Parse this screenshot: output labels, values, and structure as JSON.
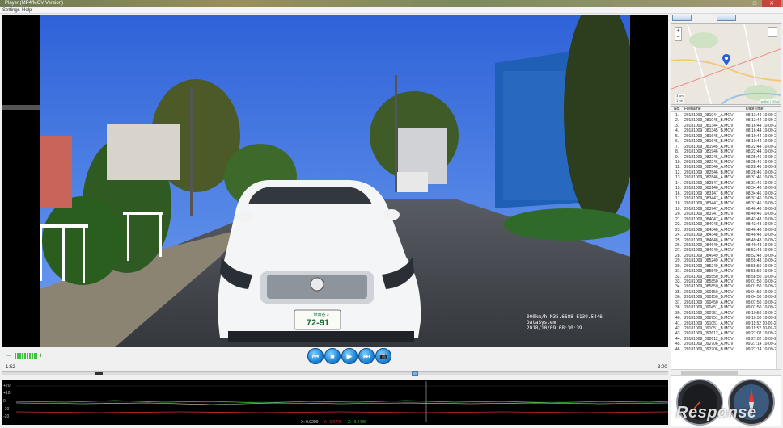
{
  "window": {
    "title": "Player (MP4/MOV Version)",
    "close": "✕"
  },
  "menu": {
    "settings": "Settings",
    "help": "Help"
  },
  "video": {
    "overlay_line1": "000km/h N35.6688 E139.5446",
    "overlay_line2": "DataSystem",
    "overlay_line3": "2018/10/09 08:30:39",
    "plate_top": "世田谷 3",
    "plate_num": "72-91"
  },
  "volume": {
    "minus": "−",
    "plus": "+"
  },
  "controls": {
    "prev": "⏮",
    "stop": "■",
    "play": "▶",
    "next": "⏭",
    "snapshot": "📷"
  },
  "playback": {
    "elapsed": "1:52",
    "duration": "3:00",
    "progress": 0.62
  },
  "graph": {
    "y_labels": [
      "+20",
      "+10",
      "0",
      "-10",
      "-20"
    ],
    "readout_x": "X: 0.0200",
    "readout_y": "Y: -0.0706",
    "readout_z": "Z: -0.2436"
  },
  "map": {
    "label_scale": "3 km",
    "label_scale2": "1 mi",
    "attrib": "Leaflet | OSM"
  },
  "filelist": {
    "headers": {
      "no": "No.",
      "filename": "Filename",
      "datetime": "DateTime"
    },
    "rows": [
      [
        "1.",
        "20181009_081044_A.MOV",
        "08:13:44 10-09-2"
      ],
      [
        "2.",
        "20181009_081045_B.MOV",
        "08:13:44 10-09-2"
      ],
      [
        "3.",
        "20181009_081344_A.MOV",
        "08:16:44 10-09-2"
      ],
      [
        "4.",
        "20181009_081345_B.MOV",
        "08:16:44 10-09-2"
      ],
      [
        "5.",
        "20181009_081645_A.MOV",
        "08:19:44 10-09-2"
      ],
      [
        "6.",
        "20181009_081645_B.MOV",
        "08:19:44 10-09-2"
      ],
      [
        "7.",
        "20181009_081945_A.MOV",
        "08:22:44 10-09-2"
      ],
      [
        "8.",
        "20181009_081946_B.MOV",
        "08:22:44 10-09-2"
      ],
      [
        "9.",
        "20181009_082246_A.MOV",
        "08:25:46 10-09-2"
      ],
      [
        "10.",
        "20181009_082246_B.MOV",
        "08:25:46 10-09-2"
      ],
      [
        "11.",
        "20181009_082546_A.MOV",
        "08:28:46 10-09-2"
      ],
      [
        "12.",
        "20181009_082546_B.MOV",
        "08:28:46 10-09-2"
      ],
      [
        "13.",
        "20181009_082846_A.MOV",
        "08:31:46 10-09-2"
      ],
      [
        "14.",
        "20181009_082847_B.MOV",
        "08:31:46 10-09-2"
      ],
      [
        "15.",
        "20181009_083146_A.MOV",
        "08:34:46 10-09-2"
      ],
      [
        "16.",
        "20181009_083147_B.MOV",
        "08:34:46 10-09-2"
      ],
      [
        "17.",
        "20181009_083447_A.MOV",
        "08:37:46 10-09-2"
      ],
      [
        "18.",
        "20181009_083447_B.MOV",
        "08:37:46 10-09-2"
      ],
      [
        "19.",
        "20181009_083747_A.MOV",
        "08:40:46 10-09-2"
      ],
      [
        "20.",
        "20181009_083747_B.MOV",
        "08:40:46 10-09-2"
      ],
      [
        "21.",
        "20181009_084047_A.MOV",
        "08:43:48 10-09-2"
      ],
      [
        "22.",
        "20181009_084048_B.MOV",
        "08:43:48 10-09-2"
      ],
      [
        "23.",
        "20181009_084348_A.MOV",
        "08:46:48 10-09-2"
      ],
      [
        "24.",
        "20181009_084348_B.MOV",
        "08:46:48 10-09-2"
      ],
      [
        "25.",
        "20181009_084648_A.MOV",
        "08:49:48 10-09-2"
      ],
      [
        "26.",
        "20181009_084649_B.MOV",
        "08:49:48 10-09-2"
      ],
      [
        "27.",
        "20181009_084949_A.MOV",
        "08:52:48 10-09-2"
      ],
      [
        "28.",
        "20181009_084949_B.MOV",
        "08:52:48 10-09-2"
      ],
      [
        "29.",
        "20181009_085249_A.MOV",
        "08:55:48 10-09-2"
      ],
      [
        "30.",
        "20181009_085249_B.MOV",
        "08:55:50 10-09-2"
      ],
      [
        "31.",
        "20181009_085549_A.MOV",
        "08:58:50 10-09-2"
      ],
      [
        "32.",
        "20181009_085550_B.MOV",
        "08:58:50 10-09-2"
      ],
      [
        "33.",
        "20181009_085850_A.MOV",
        "09:01:50 10-09-2"
      ],
      [
        "34.",
        "20181009_085850_B.MOV",
        "09:01:50 10-09-2"
      ],
      [
        "35.",
        "20181009_090150_A.MOV",
        "09:04:50 10-09-2"
      ],
      [
        "36.",
        "20181009_090150_B.MOV",
        "09:04:50 10-09-2"
      ],
      [
        "37.",
        "20181009_090450_A.MOV",
        "09:07:50 10-09-2"
      ],
      [
        "38.",
        "20181009_090451_B.MOV",
        "09:07:50 10-09-2"
      ],
      [
        "39.",
        "20181009_090751_A.MOV",
        "09:10:50 10-09-2"
      ],
      [
        "40.",
        "20181009_090751_B.MOV",
        "09:10:50 10-09-2"
      ],
      [
        "41.",
        "20181009_091051_A.MOV",
        "09:11:52 10-09-2"
      ],
      [
        "42.",
        "20181009_091051_B.MOV",
        "09:11:52 10-09-2"
      ],
      [
        "43.",
        "20181009_092612_A.MOV",
        "09:27:02 10-09-2"
      ],
      [
        "44.",
        "20181009_092612_B.MOV",
        "09:27:02 10-09-2"
      ],
      [
        "45.",
        "20181009_092706_A.MOV",
        "09:27:14 10-09-2"
      ],
      [
        "46.",
        "20181009_092706_B.MOV",
        "09:27:14 10-09-2"
      ]
    ]
  },
  "watermark": "Response",
  "colors": {
    "accent": "#1e86d8",
    "graph_green": "#3fbf3f",
    "graph_red": "#d12a2a"
  }
}
